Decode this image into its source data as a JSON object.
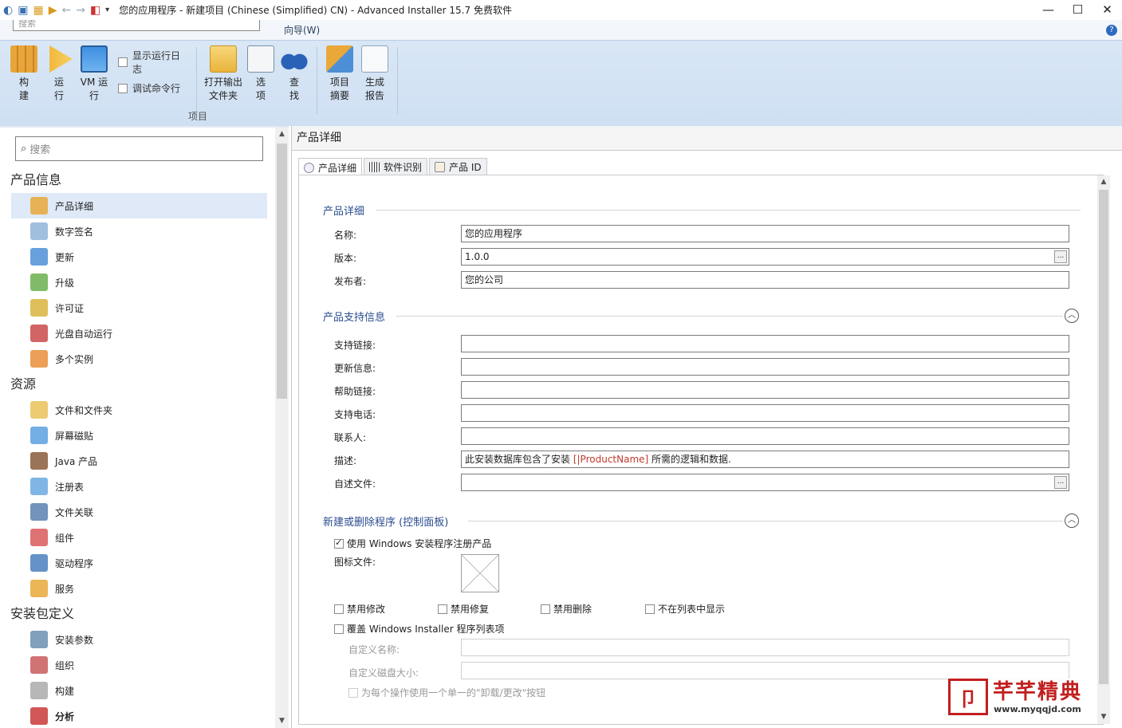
{
  "window": {
    "title": "您的应用程序 - 新建项目 (Chinese (Simplified) CN) - Advanced Installer 15.7 免费软件",
    "controls": {
      "minimize": "—",
      "maximize": "☐",
      "close": "✕"
    }
  },
  "ribbon": {
    "top_search_placeholder": "搜索",
    "tab_label": "向导(W)",
    "help": "?",
    "buttons": [
      {
        "label": "构\n建",
        "icon": "build-icon"
      },
      {
        "label": "运\n行",
        "icon": "run-icon"
      },
      {
        "label": "VM 运\n行",
        "icon": "vm-run-icon"
      },
      {
        "label": "打开输出\n文件夹",
        "icon": "open-output-folder-icon"
      },
      {
        "label": "选\n项",
        "icon": "options-icon"
      },
      {
        "label": "查\n找",
        "icon": "find-icon"
      },
      {
        "label": "项目\n摘要",
        "icon": "project-summary-icon"
      },
      {
        "label": "生成\n报告",
        "icon": "generate-report-icon"
      }
    ],
    "checks": [
      {
        "label": "显示运行日志",
        "checked": false
      },
      {
        "label": "调试命令行",
        "checked": false
      }
    ],
    "group_label": "项目"
  },
  "left_nav": {
    "search_placeholder": "搜索",
    "sections": [
      {
        "title": "产品信息",
        "items": [
          "产品详细",
          "数字签名",
          "更新",
          "升级",
          "许可证",
          "光盘自动运行",
          "多个实例"
        ]
      },
      {
        "title": "资源",
        "items": [
          "文件和文件夹",
          "屏幕磁贴",
          "Java 产品",
          "注册表",
          "文件关联",
          "组件",
          "驱动程序",
          "服务"
        ]
      },
      {
        "title": "安装包定义",
        "items": [
          "安装参数",
          "组织",
          "构建",
          "分析"
        ]
      }
    ],
    "selected": "产品详细"
  },
  "main": {
    "pane_title": "产品详细",
    "tabs": [
      "产品详细",
      "软件识别",
      "产品 ID"
    ],
    "product_details": {
      "heading": "产品详细",
      "name_label": "名称:",
      "name_value": "您的应用程序",
      "version_label": "版本:",
      "version_value": "1.0.0",
      "publisher_label": "发布者:",
      "publisher_value": "您的公司"
    },
    "support_info": {
      "heading": "产品支持信息",
      "fields": [
        "支持链接:",
        "更新信息:",
        "帮助链接:",
        "支持电话:",
        "联系人:",
        "描述:",
        "自述文件:"
      ],
      "description_prefix": "此安装数据库包含了安装 ",
      "description_token": "[|ProductName]",
      "description_suffix": " 所需的逻辑和数据."
    },
    "add_remove": {
      "heading": "新建或删除程序 (控制面板)",
      "use_windows_installer": "使用 Windows 安装程序注册产品",
      "icon_file_label": "图标文件:",
      "disable_modify": "禁用修改",
      "disable_repair": "禁用修复",
      "disable_remove": "禁用删除",
      "hide_in_list": "不在列表中显示",
      "override_entry": "覆盖 Windows Installer 程序列表项",
      "custom_name": "自定义名称:",
      "custom_disk_size": "自定义磁盘大小:",
      "single_button": "为每个操作使用一个单一的\"卸载/更改\"按钮"
    }
  },
  "watermark": {
    "logo_char": "卩",
    "name": "芊芊精典",
    "url": "www.myqqjd.com"
  }
}
